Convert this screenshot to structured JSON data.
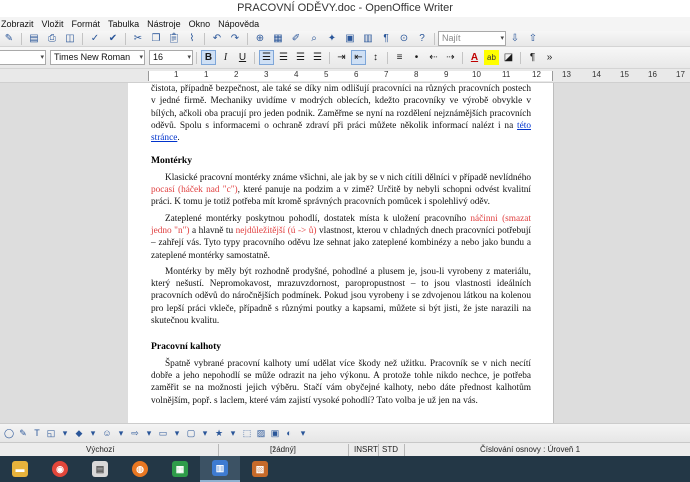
{
  "window": {
    "title": "PRACOVNÍ ODĚVY.doc - OpenOffice Writer"
  },
  "menu": {
    "items": [
      {
        "label": "Zobrazit"
      },
      {
        "label": "Vložit"
      },
      {
        "label": "Formát"
      },
      {
        "label": "Tabulka"
      },
      {
        "label": "Nástroje"
      },
      {
        "label": "Okno"
      },
      {
        "label": "Nápověda"
      }
    ]
  },
  "toolbar": {
    "font_name": "Times New Roman",
    "font_size": "16",
    "bold": "B",
    "italic": "I",
    "underline": "U",
    "search_placeholder": "Najít",
    "text_color_glyph": "A",
    "highlight_glyph": "ab"
  },
  "ruler": {
    "labels": [
      "1",
      "1",
      "2",
      "3",
      "4",
      "5",
      "6",
      "7",
      "8",
      "9",
      "10",
      "11",
      "12",
      "13",
      "14",
      "15",
      "16",
      "17",
      "18"
    ]
  },
  "document": {
    "intro": {
      "text": "čistota, případně bezpečnost, ale také se díky nim odlišují pracovníci na různých pracovních postech v jedné firmě. Mechaniky uvidíme v modrých oblecích, kdežto pracovníky ve výrobě obvykle v bílých, ačkoli oba pracují pro jeden podnik. Zaměřme se nyní na rozdělení nejznámějších pracovních oděvů. Spolu s informacemi o ochraně zdraví při práci můžete několik informací nalézt i na ",
      "link": "této stránce",
      "end": "."
    },
    "section1": {
      "heading": "Montérky",
      "p1": {
        "a": "Klasické pracovní montérky známe všichni, ale jak by se v nich cítili dělníci v případě nevlídného ",
        "red1": "pocasí (háček nad \"c\")",
        "b": ", které panuje na podzim a v zimě? Určitě by nebyli schopni odvést kvalitní práci. K tomu je totiž potřeba mít kromě správných pracovních pomůcek i spolehlivý oděv."
      },
      "p2": {
        "a": "Zateplené montérky poskytnou pohodlí, dostatek místa k uložení pracovního ",
        "red1": "náčinni (smazat jedno \"n\")",
        "b": " a hlavně tu ",
        "red2": "nejdůležitější (ú -> ů)",
        "c": " vlastnost, kterou v chladných dnech pracovníci potřebují – zahřejí vás. Tyto typy pracovního oděvu lze sehnat jako zateplené kombinézy a nebo jako bundu a zateplené montérky samostatně."
      },
      "p3": "Montérky by měly být rozhodně prodyšné, pohodlné a plusem je, jsou-li vyrobeny z materiálu, který nešustí. Nepromokavost, mrazuvzdornost, paropropustnost – to jsou vlastnosti ideálních pracovních oděvů do náročnějších podmínek. Pokud jsou vyrobeny i se zdvojenou látkou na kolenou pro lepší práci vkleče, případně s různými poutky a kapsami, můžete si být jisti, že jste narazili na skutečnou kvalitu."
    },
    "section2": {
      "heading": "Pracovní kalhoty",
      "p1": "Špatně vybrané pracovní kalhoty umí udělat více škody než užitku. Pracovník se v nich necítí dobře a jeho nepohodlí se může odrazit na jeho výkonu. A protože tohle nikdo nechce, je potřeba zaměřit se na možnosti jejich výběru. Stačí vám obyčejné kalhoty, nebo dáte přednost kalhotům volnějším, popř. s laclem, které vám zajistí vysoké pohodlí? Tato volba je už jen na vás."
    }
  },
  "statusbar": {
    "style": "Výchozí",
    "language": "[žádný]",
    "insert_mode": "INSRT",
    "selection_mode": "STD",
    "outline": "Číslování osnovy : Úroveň 1"
  },
  "taskbar": {
    "apps": [
      {
        "name": "file-explorer-icon"
      },
      {
        "name": "chrome-icon"
      },
      {
        "name": "files-icon"
      },
      {
        "name": "firefox-icon"
      },
      {
        "name": "calc-icon"
      },
      {
        "name": "writer-icon"
      },
      {
        "name": "impress-icon"
      }
    ]
  }
}
